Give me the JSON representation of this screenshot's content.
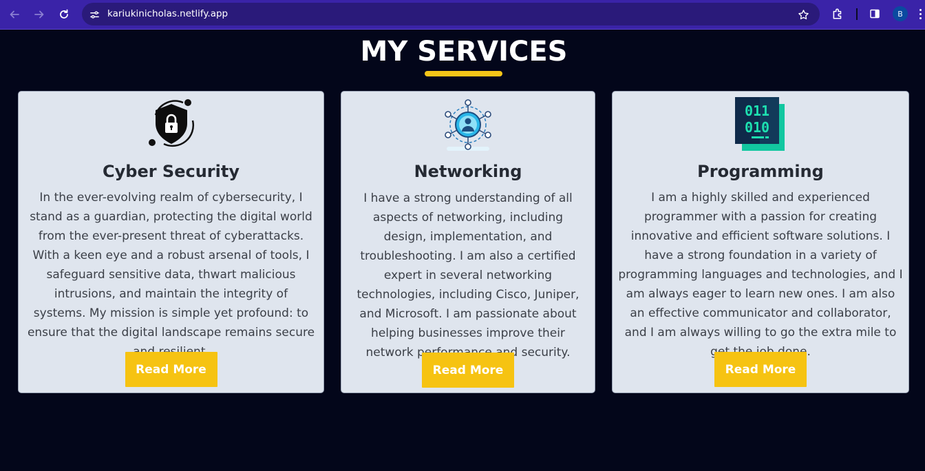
{
  "browser": {
    "url": "kariukinicholas.netlify.app",
    "profile_initial": "B",
    "icons": [
      "back-arrow-icon",
      "forward-arrow-icon",
      "reload-icon",
      "site-settings-icon",
      "bookmark-star-icon",
      "extensions-icon",
      "side-panel-icon",
      "menu-icon"
    ]
  },
  "page": {
    "heading": "MY SERVICES",
    "accent_color": "#f5c518",
    "background_color": "#03061a"
  },
  "services": [
    {
      "title": "Cyber Security",
      "icon": "shield-lock-icon",
      "description": "In the ever-evolving realm of cybersecurity, I stand as a guardian, protecting the digital world from the ever-present threat of cyberattacks. With a keen eye and a robust arsenal of tools, I safeguard sensitive data, thwart malicious intrusions, and maintain the integrity of systems. My mission is simple yet profound: to ensure that the digital landscape remains secure and resilient.",
      "button_label": "Read More"
    },
    {
      "title": "Networking",
      "icon": "network-user-icon",
      "description": "I have a strong understanding of all aspects of networking, including design, implementation, and troubleshooting. I am also a certified expert in several networking technologies, including Cisco, Juniper, and Microsoft. I am passionate about helping businesses improve their network performance and security.",
      "button_label": "Read More"
    },
    {
      "title": "Programming",
      "icon": "binary-code-icon",
      "icon_text_line1": "011",
      "icon_text_line2": "010",
      "description": "I am a highly skilled and experienced programmer with a passion for creating innovative and efficient software solutions. I have a strong foundation in a variety of programming languages and technologies, and I am always eager to learn new ones. I am also an effective communicator and collaborator, and I am always willing to go the extra mile to get the job done.",
      "button_label": "Read More"
    }
  ]
}
